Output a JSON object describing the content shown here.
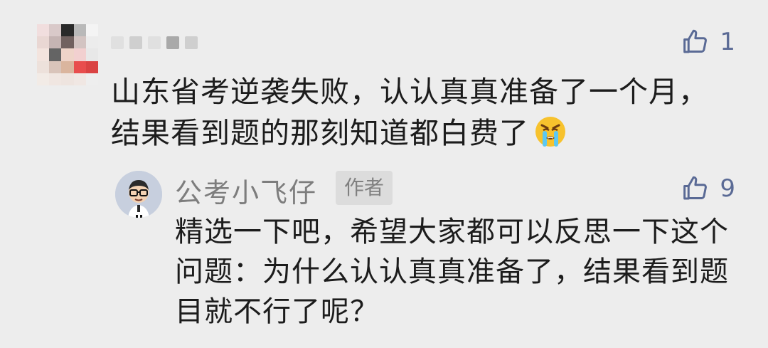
{
  "comment": {
    "text": "山东省考逆袭失败，认认真真准备了一个月，结果看到题的那刻知道都白费了",
    "emoji": "crying-face-icon",
    "likes": "1"
  },
  "reply": {
    "author": "公考小飞仔",
    "badge": "作者",
    "text": "精选一下吧，希望大家都可以反思一下这个问题：为什么认认真真准备了，结果看到题目就不行了呢？",
    "likes": "9"
  },
  "colors": {
    "background": "#ededed",
    "like": "#5a6a95",
    "text": "#1c1c1c",
    "name": "#7d7d7d",
    "badge_bg": "#dcdcdc"
  }
}
